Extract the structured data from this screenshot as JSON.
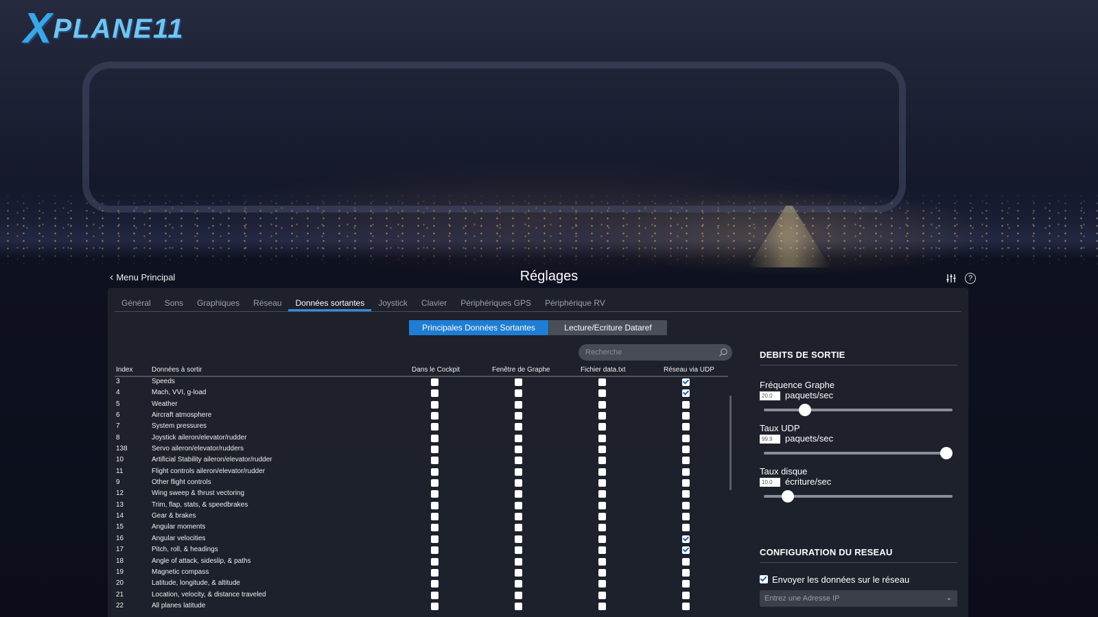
{
  "logo": {
    "x": "X",
    "rest": "PLANE11"
  },
  "header": {
    "back_label": "Menu Principal",
    "title": "Réglages"
  },
  "tabs": [
    {
      "label": "Général",
      "active": false
    },
    {
      "label": "Sons",
      "active": false
    },
    {
      "label": "Graphiques",
      "active": false
    },
    {
      "label": "Réseau",
      "active": false
    },
    {
      "label": "Données sortantes",
      "active": true
    },
    {
      "label": "Joystick",
      "active": false
    },
    {
      "label": "Clavier",
      "active": false
    },
    {
      "label": "Périphériques GPS",
      "active": false
    },
    {
      "label": "Périphérique  RV",
      "active": false
    }
  ],
  "subtabs": {
    "main": "Principales Données Sortantes",
    "dataref": "Lecture/Ecriture Dataref"
  },
  "search": {
    "placeholder": "Recherche"
  },
  "table": {
    "headers": {
      "index": "Index",
      "data": "Données à sortir",
      "cockpit": "Dans le Cockpit",
      "graph": "Fenêtre de Graphe",
      "file": "Fichier data.txt",
      "udp": "Réseau via UDP"
    },
    "rows": [
      {
        "index": "3",
        "name": "Speeds",
        "cockpit": false,
        "graph": false,
        "file": false,
        "udp": true
      },
      {
        "index": "4",
        "name": "Mach, VVI, g-load",
        "cockpit": false,
        "graph": false,
        "file": false,
        "udp": true
      },
      {
        "index": "5",
        "name": "Weather",
        "cockpit": false,
        "graph": false,
        "file": false,
        "udp": false
      },
      {
        "index": "6",
        "name": "Aircraft atmosphere",
        "cockpit": false,
        "graph": false,
        "file": false,
        "udp": false
      },
      {
        "index": "7",
        "name": "System pressures",
        "cockpit": false,
        "graph": false,
        "file": false,
        "udp": false
      },
      {
        "index": "8",
        "name": "Joystick aileron/elevator/rudder",
        "cockpit": false,
        "graph": false,
        "file": false,
        "udp": false
      },
      {
        "index": "138",
        "name": "Servo aileron/elevator/rudders",
        "cockpit": false,
        "graph": false,
        "file": false,
        "udp": false
      },
      {
        "index": "10",
        "name": "Artificial Stability aileron/elevator/rudder",
        "cockpit": false,
        "graph": false,
        "file": false,
        "udp": false
      },
      {
        "index": "11",
        "name": "Flight controls aileron/elevator/rudder",
        "cockpit": false,
        "graph": false,
        "file": false,
        "udp": false
      },
      {
        "index": "9",
        "name": "Other flight controls",
        "cockpit": false,
        "graph": false,
        "file": false,
        "udp": false
      },
      {
        "index": "12",
        "name": "Wing sweep & thrust vectoring",
        "cockpit": false,
        "graph": false,
        "file": false,
        "udp": false
      },
      {
        "index": "13",
        "name": "Trim, flap, stats, & speedbrakes",
        "cockpit": false,
        "graph": false,
        "file": false,
        "udp": false
      },
      {
        "index": "14",
        "name": "Gear & brakes",
        "cockpit": false,
        "graph": false,
        "file": false,
        "udp": false
      },
      {
        "index": "15",
        "name": "Angular moments",
        "cockpit": false,
        "graph": false,
        "file": false,
        "udp": false
      },
      {
        "index": "16",
        "name": "Angular velocities",
        "cockpit": false,
        "graph": false,
        "file": false,
        "udp": true
      },
      {
        "index": "17",
        "name": "Pitch, roll, & headings",
        "cockpit": false,
        "graph": false,
        "file": false,
        "udp": true
      },
      {
        "index": "18",
        "name": "Angle of attack, sideslip, & paths",
        "cockpit": false,
        "graph": false,
        "file": false,
        "udp": false
      },
      {
        "index": "19",
        "name": "Magnetic compass",
        "cockpit": false,
        "graph": false,
        "file": false,
        "udp": false
      },
      {
        "index": "20",
        "name": "Latitude, longitude, & altitude",
        "cockpit": false,
        "graph": false,
        "file": false,
        "udp": false
      },
      {
        "index": "21",
        "name": "Location, velocity, & distance traveled",
        "cockpit": false,
        "graph": false,
        "file": false,
        "udp": false
      },
      {
        "index": "22",
        "name": "All planes latitude",
        "cockpit": false,
        "graph": false,
        "file": false,
        "udp": false
      }
    ]
  },
  "output_rates": {
    "title": "DEBITS DE SORTIE",
    "graph_freq": {
      "label": "Fréquence Graphe",
      "value": "20.0",
      "unit": "paquets/sec",
      "level": 0.2
    },
    "udp_rate": {
      "label": "Taux UDP",
      "value": "99.9",
      "unit": "paquets/sec",
      "level": 1.0
    },
    "disk_rate": {
      "label": "Taux disque",
      "value": "10.0",
      "unit": "écriture/sec",
      "level": 0.1
    }
  },
  "network": {
    "title": "CONFIGURATION DU RESEAU",
    "send_label": "Envoyer les données sur le réseau",
    "send_checked": true,
    "ip_placeholder": "Entrez une Adresse IP"
  },
  "colors": {
    "accent": "#1f7dd4",
    "panel": "#20232c"
  }
}
